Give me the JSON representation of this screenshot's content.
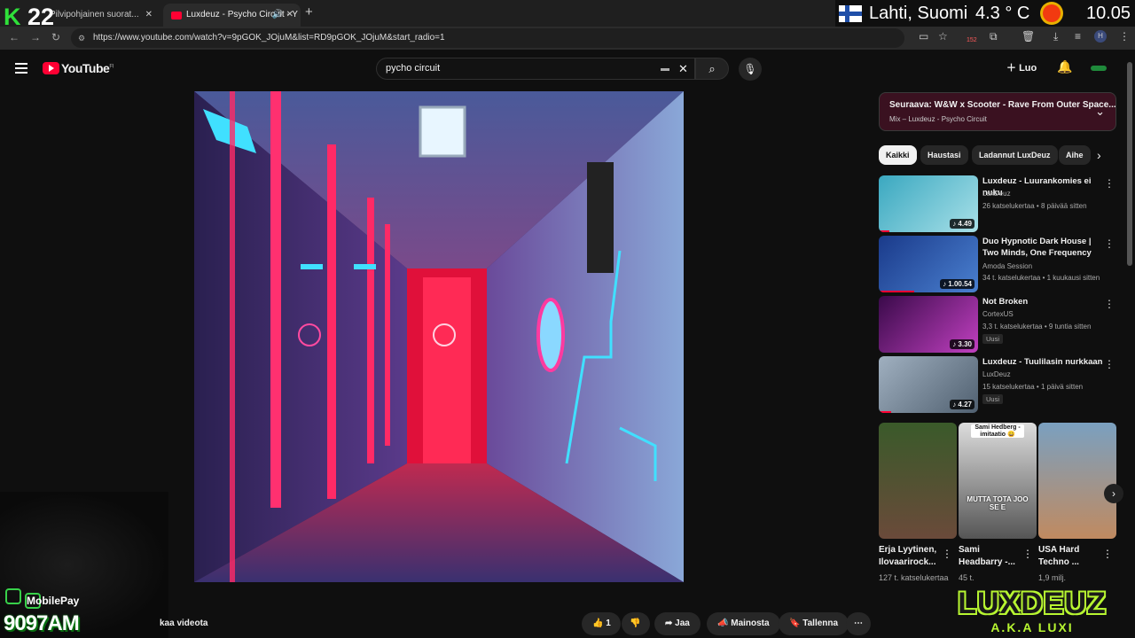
{
  "browser": {
    "tabs": [
      {
        "label": "Pilvipohjainen suorat..."
      },
      {
        "label": "Luxdeuz - Psycho Circuit - Y"
      }
    ],
    "url": "https://www.youtube.com/watch?v=9pGOK_JOjuM&list=RD9pGOK_JOjuM&start_radio=1",
    "badge_count": "152",
    "profile_initial": "H"
  },
  "overlay": {
    "k_number": "22",
    "weather_location": "Lahti, Suomi",
    "weather_temp": "4.3 ° C",
    "clock": "10.05",
    "mobilepay_label": "MobilePay",
    "mobilepay_amount": "9097AM",
    "brand_big": "LUXDEUZ",
    "brand_small": "A.K.A LUXI"
  },
  "youtube": {
    "logo_text": "YouTube",
    "logo_region": "FI",
    "search_query": "pycho circuit",
    "create_label": "Luo"
  },
  "player_actions": {
    "left_text": "kaa videota",
    "like_count": "1",
    "share": "Jaa",
    "advertise": "Mainosta",
    "save": "Tallenna"
  },
  "up_next": {
    "title": "Seuraava: W&W x Scooter - Rave From Outer Space...",
    "subtitle": "Mix – Luxdeuz - Psycho Circuit"
  },
  "chips": [
    "Kaikki",
    "Haustasi",
    "Ladannut LuxDeuz",
    "Aihe"
  ],
  "recommendations": [
    {
      "title": "Luxdeuz - Luurankomies ei nuku",
      "channel": "LuxDeuz",
      "meta": "26 katselukertaa • 8 päivää sitten",
      "duration": "♪ 4.49",
      "badge": ""
    },
    {
      "title": "Duo Hypnotic Dark House | Two Minds, One Frequency",
      "channel": "Amoda Session",
      "meta": "34 t. katselukertaa • 1 kuukausi sitten",
      "duration": "♪ 1.00.54",
      "badge": ""
    },
    {
      "title": "Not Broken",
      "channel": "CortexUS",
      "meta": "3,3 t. katselukertaa • 9 tuntia sitten",
      "duration": "♪ 3.30",
      "badge": "Uusi"
    },
    {
      "title": "Luxdeuz - Tuulilasin nurkkaan",
      "channel": "LuxDeuz",
      "meta": "15 katselukertaa • 1 päivä sitten",
      "duration": "♪ 4.27",
      "badge": "Uusi"
    }
  ],
  "shorts": [
    {
      "title": "Erja Lyytinen, Ilovaarirock...",
      "meta": "127 t. katselukertaa",
      "overlay": ""
    },
    {
      "title": "Sami Headbarry -...",
      "meta": "45 t.",
      "overlay": "MUTTA TOTA JOO SE E",
      "top_caption": "Sami Hedberg -imitaatio 😄"
    },
    {
      "title": "USA Hard Techno ...",
      "meta": "1,9 milj.",
      "overlay": ""
    }
  ],
  "colors": {
    "youtube_red": "#ff0033",
    "overlay_green": "#b7f531",
    "upnext_bg": "#3a1120"
  }
}
